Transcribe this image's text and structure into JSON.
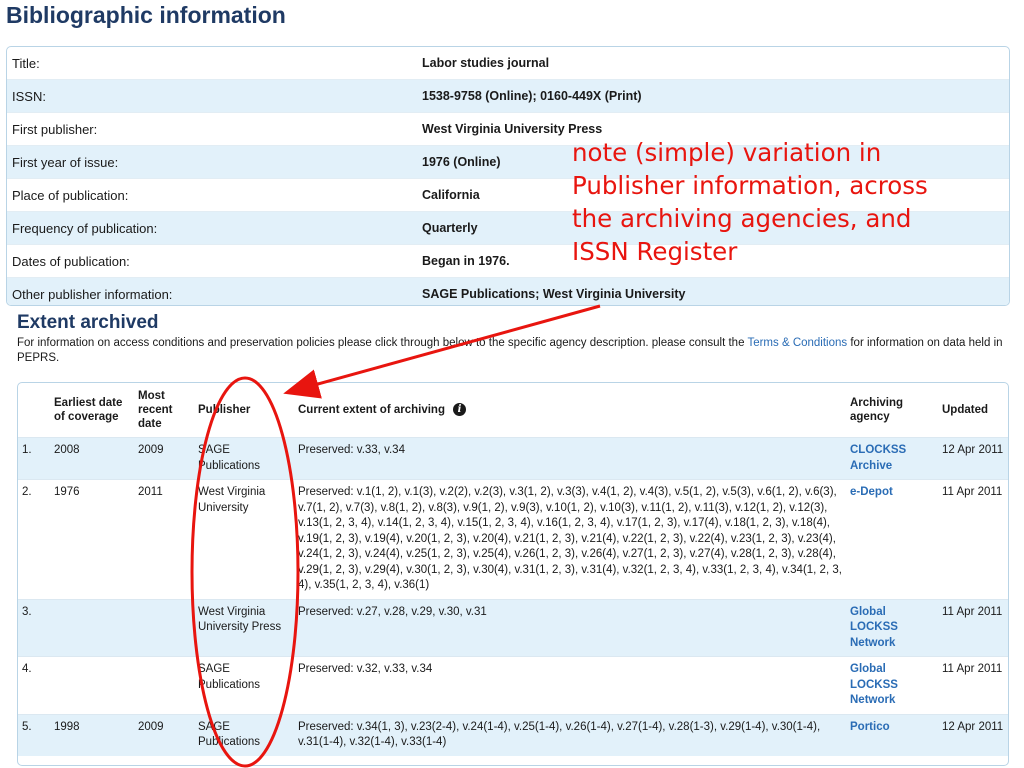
{
  "heading": "Bibliographic information",
  "bibliographic": [
    {
      "label": "Title:",
      "value": "Labor studies journal"
    },
    {
      "label": "ISSN:",
      "value": "1538-9758 (Online); 0160-449X (Print)"
    },
    {
      "label": "First publisher:",
      "value": "West Virginia University Press"
    },
    {
      "label": "First year of issue:",
      "value": "1976 (Online)"
    },
    {
      "label": "Place of publication:",
      "value": "California"
    },
    {
      "label": "Frequency of publication:",
      "value": "Quarterly"
    },
    {
      "label": "Dates of publication:",
      "value": "Began in 1976."
    },
    {
      "label": "Other publisher information:",
      "value": "SAGE Publications; West Virginia University"
    }
  ],
  "annotation": "note (simple) variation in\nPublisher information, across\nthe archiving agencies, and\nISSN Register",
  "extent": {
    "title": "Extent archived",
    "desc_before": "For information on access conditions and preservation policies please click through below to the specific agency description. please consult the ",
    "desc_link": "Terms & Conditions",
    "desc_after": " for information on data held in PEPRS."
  },
  "table": {
    "headers": {
      "earliest": "Earliest date of coverage",
      "recent": "Most recent date",
      "publisher": "Publisher",
      "extent": "Current extent of archiving",
      "agency": "Archiving agency",
      "updated": "Updated"
    },
    "rows": [
      {
        "num": "1.",
        "earliest": "2008",
        "recent": "2009",
        "publisher": "SAGE Publications",
        "extent": "Preserved: v.33, v.34",
        "agency": "CLOCKSS Archive",
        "updated": "12 Apr 2011"
      },
      {
        "num": "2.",
        "earliest": "1976",
        "recent": "2011",
        "publisher": "West Virginia University",
        "extent": "Preserved: v.1(1, 2), v.1(3), v.2(2), v.2(3), v.3(1, 2), v.3(3), v.4(1, 2), v.4(3), v.5(1, 2), v.5(3), v.6(1, 2), v.6(3), v.7(1, 2), v.7(3), v.8(1, 2), v.8(3), v.9(1, 2), v.9(3), v.10(1, 2), v.10(3), v.11(1, 2), v.11(3), v.12(1, 2), v.12(3), v.13(1, 2, 3, 4), v.14(1, 2, 3, 4), v.15(1, 2, 3, 4), v.16(1, 2, 3, 4), v.17(1, 2, 3), v.17(4), v.18(1, 2, 3), v.18(4), v.19(1, 2, 3), v.19(4), v.20(1, 2, 3), v.20(4), v.21(1, 2, 3), v.21(4), v.22(1, 2, 3), v.22(4), v.23(1, 2, 3), v.23(4), v.24(1, 2, 3), v.24(4), v.25(1, 2, 3), v.25(4), v.26(1, 2, 3), v.26(4), v.27(1, 2, 3), v.27(4), v.28(1, 2, 3), v.28(4), v.29(1, 2, 3), v.29(4), v.30(1, 2, 3), v.30(4), v.31(1, 2, 3), v.31(4), v.32(1, 2, 3, 4), v.33(1, 2, 3, 4), v.34(1, 2, 3, 4), v.35(1, 2, 3, 4), v.36(1)",
        "agency": "e-Depot",
        "updated": "11 Apr 2011"
      },
      {
        "num": "3.",
        "earliest": "",
        "recent": "",
        "publisher": "West Virginia University Press",
        "extent": "Preserved: v.27, v.28, v.29, v.30, v.31",
        "agency": "Global LOCKSS Network",
        "updated": "11 Apr 2011"
      },
      {
        "num": "4.",
        "earliest": "",
        "recent": "",
        "publisher": "SAGE Publications",
        "extent": "Preserved: v.32, v.33, v.34",
        "agency": "Global LOCKSS Network",
        "updated": "11 Apr 2011"
      },
      {
        "num": "5.",
        "earliest": "1998",
        "recent": "2009",
        "publisher": "SAGE Publications",
        "extent": "Preserved: v.34(1, 3), v.23(2-4), v.24(1-4), v.25(1-4), v.26(1-4), v.27(1-4), v.28(1-3), v.29(1-4), v.30(1-4), v.31(1-4), v.32(1-4), v.33(1-4)",
        "agency": "Portico",
        "updated": "12 Apr 2011"
      }
    ]
  },
  "colors": {
    "heading": "#1f3a64",
    "link": "#2a6cb5",
    "row_stripe": "#e2f1fa",
    "annotation": "#e8150f"
  },
  "icons": {
    "info": "info-icon"
  }
}
